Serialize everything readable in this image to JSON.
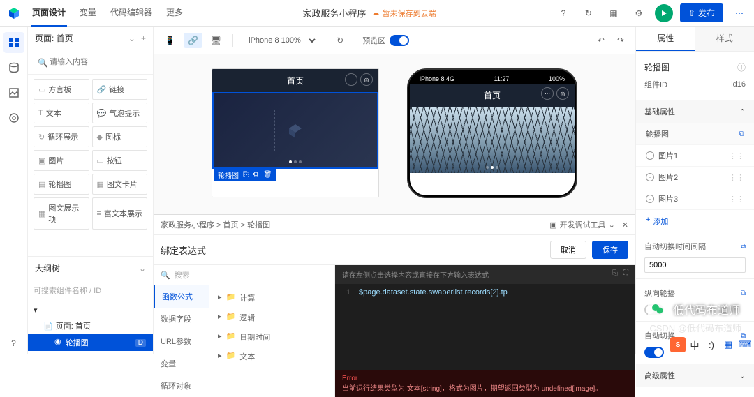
{
  "header": {
    "tabs": [
      "页面设计",
      "变量",
      "代码编辑器",
      "更多"
    ],
    "app_title": "家政服务小程序",
    "cloud_status": "暂未保存到云端",
    "publish_label": "发布"
  },
  "left": {
    "page_label": "页面: 首页",
    "search_placeholder": "请输入内容",
    "components": [
      "方言板",
      "链接",
      "文本",
      "气泡提示",
      "循环展示",
      "图标",
      "图片",
      "按钮",
      "轮播图",
      "图文卡片",
      "图文展示项",
      "富文本展示"
    ],
    "outline_label": "大纲树",
    "outline_search": "可搜索组件名称 / ID",
    "tree": {
      "page": "页面: 首页",
      "selected": "轮播图",
      "badge": "D"
    }
  },
  "canvas": {
    "device": "iPhone 8 100%",
    "preview_label": "预览区",
    "frame1_title": "首页",
    "carousel_tag": "轮播图",
    "phone_status": {
      "carrier": "iPhone 8  4G",
      "time": "11:27",
      "battery": "100%"
    },
    "frame2_title": "首页"
  },
  "expr": {
    "breadcrumb": "家政服务小程序  >  首页  >  轮播图",
    "dev_tools": "开发调试工具",
    "title": "绑定表达式",
    "cancel": "取消",
    "save": "保存",
    "search": "搜索",
    "cats": [
      "函数公式",
      "数据字段",
      "URL参数",
      "变量",
      "循环对象"
    ],
    "folders": [
      "计算",
      "逻辑",
      "日期时间",
      "文本"
    ],
    "code_hint": "请在左侧点击选择内容或直接在下方输入表达式",
    "code": "$page.dataset.state.swaperlist.records[2].tp",
    "error_label": "Error",
    "error_msg": "当前运行结果类型为 文本[string]，格式为图片，期望返回类型为 undefined[image]。"
  },
  "right": {
    "tabs": [
      "属性",
      "样式"
    ],
    "comp_name": "轮播图",
    "id_label": "组件ID",
    "id_val": "id16",
    "basic_label": "基础属性",
    "list_label": "轮播图",
    "images": [
      "图片1",
      "图片2",
      "图片3"
    ],
    "add": "添加",
    "interval_label": "自动切换时间间隔",
    "interval_val": "5000",
    "vertical_label": "纵向轮播",
    "autoplay_label": "自动切换",
    "advanced_label": "高级属性"
  },
  "watermark": {
    "line1": "低代码布道师",
    "line2": "CSDN @低代码布道师"
  }
}
